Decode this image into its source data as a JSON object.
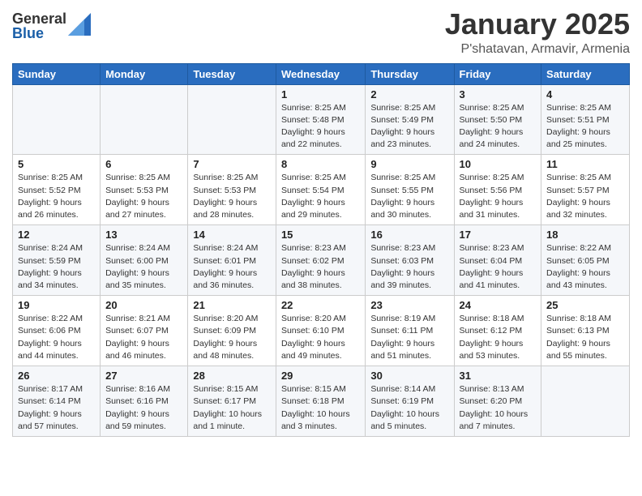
{
  "logo": {
    "general": "General",
    "blue": "Blue"
  },
  "header": {
    "month": "January 2025",
    "location": "P'shatavan, Armavir, Armenia"
  },
  "weekdays": [
    "Sunday",
    "Monday",
    "Tuesday",
    "Wednesday",
    "Thursday",
    "Friday",
    "Saturday"
  ],
  "weeks": [
    [
      {
        "day": "",
        "sunrise": "",
        "sunset": "",
        "daylight": ""
      },
      {
        "day": "",
        "sunrise": "",
        "sunset": "",
        "daylight": ""
      },
      {
        "day": "",
        "sunrise": "",
        "sunset": "",
        "daylight": ""
      },
      {
        "day": "1",
        "sunrise": "Sunrise: 8:25 AM",
        "sunset": "Sunset: 5:48 PM",
        "daylight": "Daylight: 9 hours and 22 minutes."
      },
      {
        "day": "2",
        "sunrise": "Sunrise: 8:25 AM",
        "sunset": "Sunset: 5:49 PM",
        "daylight": "Daylight: 9 hours and 23 minutes."
      },
      {
        "day": "3",
        "sunrise": "Sunrise: 8:25 AM",
        "sunset": "Sunset: 5:50 PM",
        "daylight": "Daylight: 9 hours and 24 minutes."
      },
      {
        "day": "4",
        "sunrise": "Sunrise: 8:25 AM",
        "sunset": "Sunset: 5:51 PM",
        "daylight": "Daylight: 9 hours and 25 minutes."
      }
    ],
    [
      {
        "day": "5",
        "sunrise": "Sunrise: 8:25 AM",
        "sunset": "Sunset: 5:52 PM",
        "daylight": "Daylight: 9 hours and 26 minutes."
      },
      {
        "day": "6",
        "sunrise": "Sunrise: 8:25 AM",
        "sunset": "Sunset: 5:53 PM",
        "daylight": "Daylight: 9 hours and 27 minutes."
      },
      {
        "day": "7",
        "sunrise": "Sunrise: 8:25 AM",
        "sunset": "Sunset: 5:53 PM",
        "daylight": "Daylight: 9 hours and 28 minutes."
      },
      {
        "day": "8",
        "sunrise": "Sunrise: 8:25 AM",
        "sunset": "Sunset: 5:54 PM",
        "daylight": "Daylight: 9 hours and 29 minutes."
      },
      {
        "day": "9",
        "sunrise": "Sunrise: 8:25 AM",
        "sunset": "Sunset: 5:55 PM",
        "daylight": "Daylight: 9 hours and 30 minutes."
      },
      {
        "day": "10",
        "sunrise": "Sunrise: 8:25 AM",
        "sunset": "Sunset: 5:56 PM",
        "daylight": "Daylight: 9 hours and 31 minutes."
      },
      {
        "day": "11",
        "sunrise": "Sunrise: 8:25 AM",
        "sunset": "Sunset: 5:57 PM",
        "daylight": "Daylight: 9 hours and 32 minutes."
      }
    ],
    [
      {
        "day": "12",
        "sunrise": "Sunrise: 8:24 AM",
        "sunset": "Sunset: 5:59 PM",
        "daylight": "Daylight: 9 hours and 34 minutes."
      },
      {
        "day": "13",
        "sunrise": "Sunrise: 8:24 AM",
        "sunset": "Sunset: 6:00 PM",
        "daylight": "Daylight: 9 hours and 35 minutes."
      },
      {
        "day": "14",
        "sunrise": "Sunrise: 8:24 AM",
        "sunset": "Sunset: 6:01 PM",
        "daylight": "Daylight: 9 hours and 36 minutes."
      },
      {
        "day": "15",
        "sunrise": "Sunrise: 8:23 AM",
        "sunset": "Sunset: 6:02 PM",
        "daylight": "Daylight: 9 hours and 38 minutes."
      },
      {
        "day": "16",
        "sunrise": "Sunrise: 8:23 AM",
        "sunset": "Sunset: 6:03 PM",
        "daylight": "Daylight: 9 hours and 39 minutes."
      },
      {
        "day": "17",
        "sunrise": "Sunrise: 8:23 AM",
        "sunset": "Sunset: 6:04 PM",
        "daylight": "Daylight: 9 hours and 41 minutes."
      },
      {
        "day": "18",
        "sunrise": "Sunrise: 8:22 AM",
        "sunset": "Sunset: 6:05 PM",
        "daylight": "Daylight: 9 hours and 43 minutes."
      }
    ],
    [
      {
        "day": "19",
        "sunrise": "Sunrise: 8:22 AM",
        "sunset": "Sunset: 6:06 PM",
        "daylight": "Daylight: 9 hours and 44 minutes."
      },
      {
        "day": "20",
        "sunrise": "Sunrise: 8:21 AM",
        "sunset": "Sunset: 6:07 PM",
        "daylight": "Daylight: 9 hours and 46 minutes."
      },
      {
        "day": "21",
        "sunrise": "Sunrise: 8:20 AM",
        "sunset": "Sunset: 6:09 PM",
        "daylight": "Daylight: 9 hours and 48 minutes."
      },
      {
        "day": "22",
        "sunrise": "Sunrise: 8:20 AM",
        "sunset": "Sunset: 6:10 PM",
        "daylight": "Daylight: 9 hours and 49 minutes."
      },
      {
        "day": "23",
        "sunrise": "Sunrise: 8:19 AM",
        "sunset": "Sunset: 6:11 PM",
        "daylight": "Daylight: 9 hours and 51 minutes."
      },
      {
        "day": "24",
        "sunrise": "Sunrise: 8:18 AM",
        "sunset": "Sunset: 6:12 PM",
        "daylight": "Daylight: 9 hours and 53 minutes."
      },
      {
        "day": "25",
        "sunrise": "Sunrise: 8:18 AM",
        "sunset": "Sunset: 6:13 PM",
        "daylight": "Daylight: 9 hours and 55 minutes."
      }
    ],
    [
      {
        "day": "26",
        "sunrise": "Sunrise: 8:17 AM",
        "sunset": "Sunset: 6:14 PM",
        "daylight": "Daylight: 9 hours and 57 minutes."
      },
      {
        "day": "27",
        "sunrise": "Sunrise: 8:16 AM",
        "sunset": "Sunset: 6:16 PM",
        "daylight": "Daylight: 9 hours and 59 minutes."
      },
      {
        "day": "28",
        "sunrise": "Sunrise: 8:15 AM",
        "sunset": "Sunset: 6:17 PM",
        "daylight": "Daylight: 10 hours and 1 minute."
      },
      {
        "day": "29",
        "sunrise": "Sunrise: 8:15 AM",
        "sunset": "Sunset: 6:18 PM",
        "daylight": "Daylight: 10 hours and 3 minutes."
      },
      {
        "day": "30",
        "sunrise": "Sunrise: 8:14 AM",
        "sunset": "Sunset: 6:19 PM",
        "daylight": "Daylight: 10 hours and 5 minutes."
      },
      {
        "day": "31",
        "sunrise": "Sunrise: 8:13 AM",
        "sunset": "Sunset: 6:20 PM",
        "daylight": "Daylight: 10 hours and 7 minutes."
      },
      {
        "day": "",
        "sunrise": "",
        "sunset": "",
        "daylight": ""
      }
    ]
  ]
}
